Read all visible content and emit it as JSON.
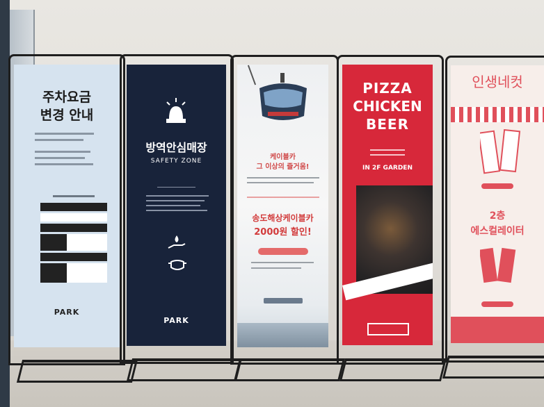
{
  "banners": {
    "parking": {
      "title_line1": "주차요금",
      "title_line2": "변경 안내",
      "logo": "PARK"
    },
    "safety": {
      "title": "방역안심매장",
      "subtitle": "SAFETY ZONE",
      "logo": "PARK"
    },
    "cable_car": {
      "headline1": "케이블카",
      "headline2": "그 이상의 즐거움!",
      "promo_line1": "송도해상케이블카",
      "promo_line2": "2000원 할인!"
    },
    "pizza": {
      "line1": "PIZZA",
      "line2": "CHICKEN",
      "line3": "BEER",
      "tagline": "IN 2F GARDEN"
    },
    "photo_booth": {
      "title": "인생네컷",
      "floor": "2층",
      "escalator": "에스컬레이터"
    }
  },
  "colors": {
    "parking_bg": "#d6e3ef",
    "safety_bg": "#18233a",
    "pizza_bg": "#d7283a",
    "booth_accent": "#e0505b"
  },
  "icons": [
    "siren-icon",
    "hand-drop-icon",
    "mask-icon",
    "cable-car-icon",
    "pizza-plate-photo",
    "photo-strip-icon"
  ]
}
